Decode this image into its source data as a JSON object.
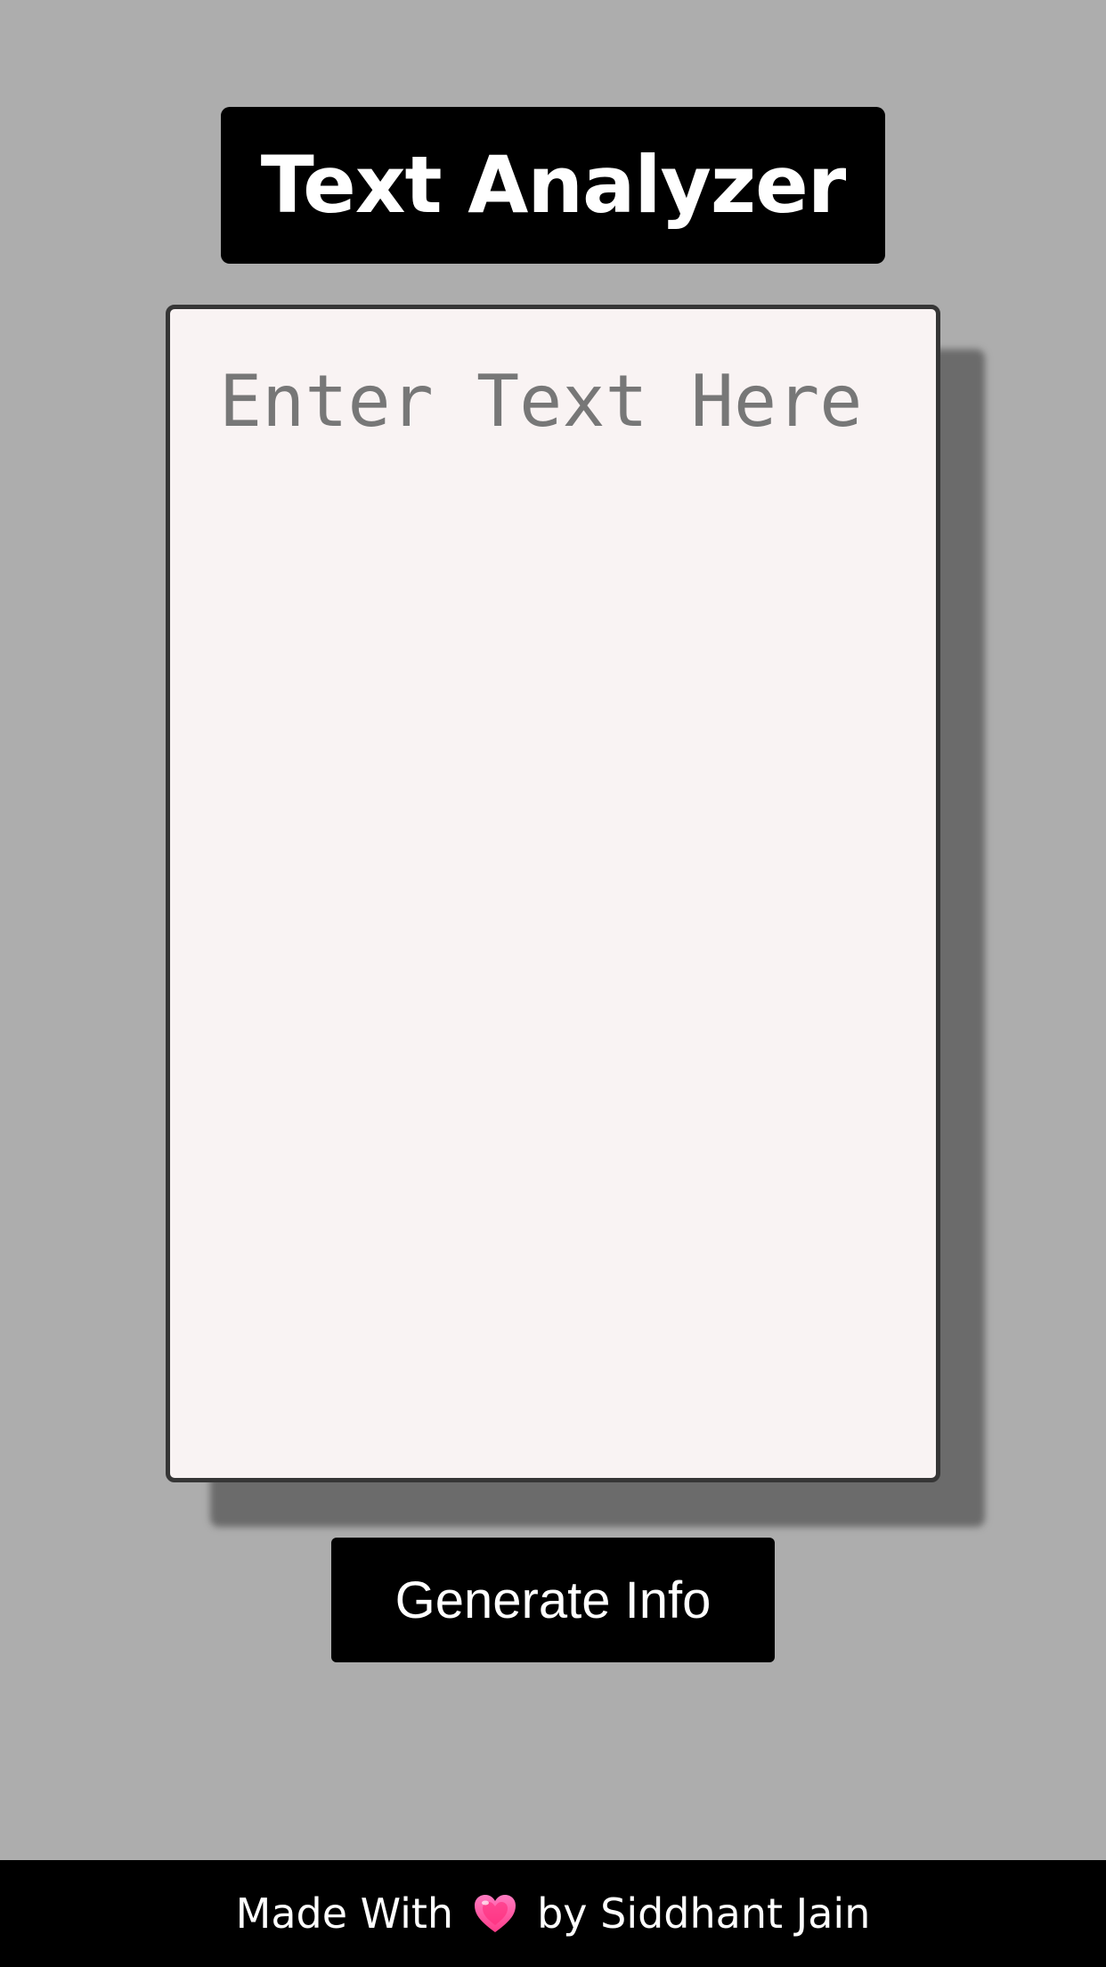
{
  "header": {
    "title": "Text Analyzer"
  },
  "editor": {
    "placeholder": "Enter Text Here",
    "value": ""
  },
  "actions": {
    "generate_label": "Generate Info"
  },
  "footer": {
    "made_with": "Made With",
    "by_author": "by Siddhant Jain",
    "icon": "heart-icon"
  },
  "colors": {
    "background": "#adadad",
    "title_bg": "#000000",
    "editor_bg": "#f9f3f3",
    "editor_border": "#363636",
    "editor_shadow": "#6b6b6b",
    "button_bg": "#000000",
    "footer_bg": "#000000",
    "heart": "#ff4f9a"
  }
}
